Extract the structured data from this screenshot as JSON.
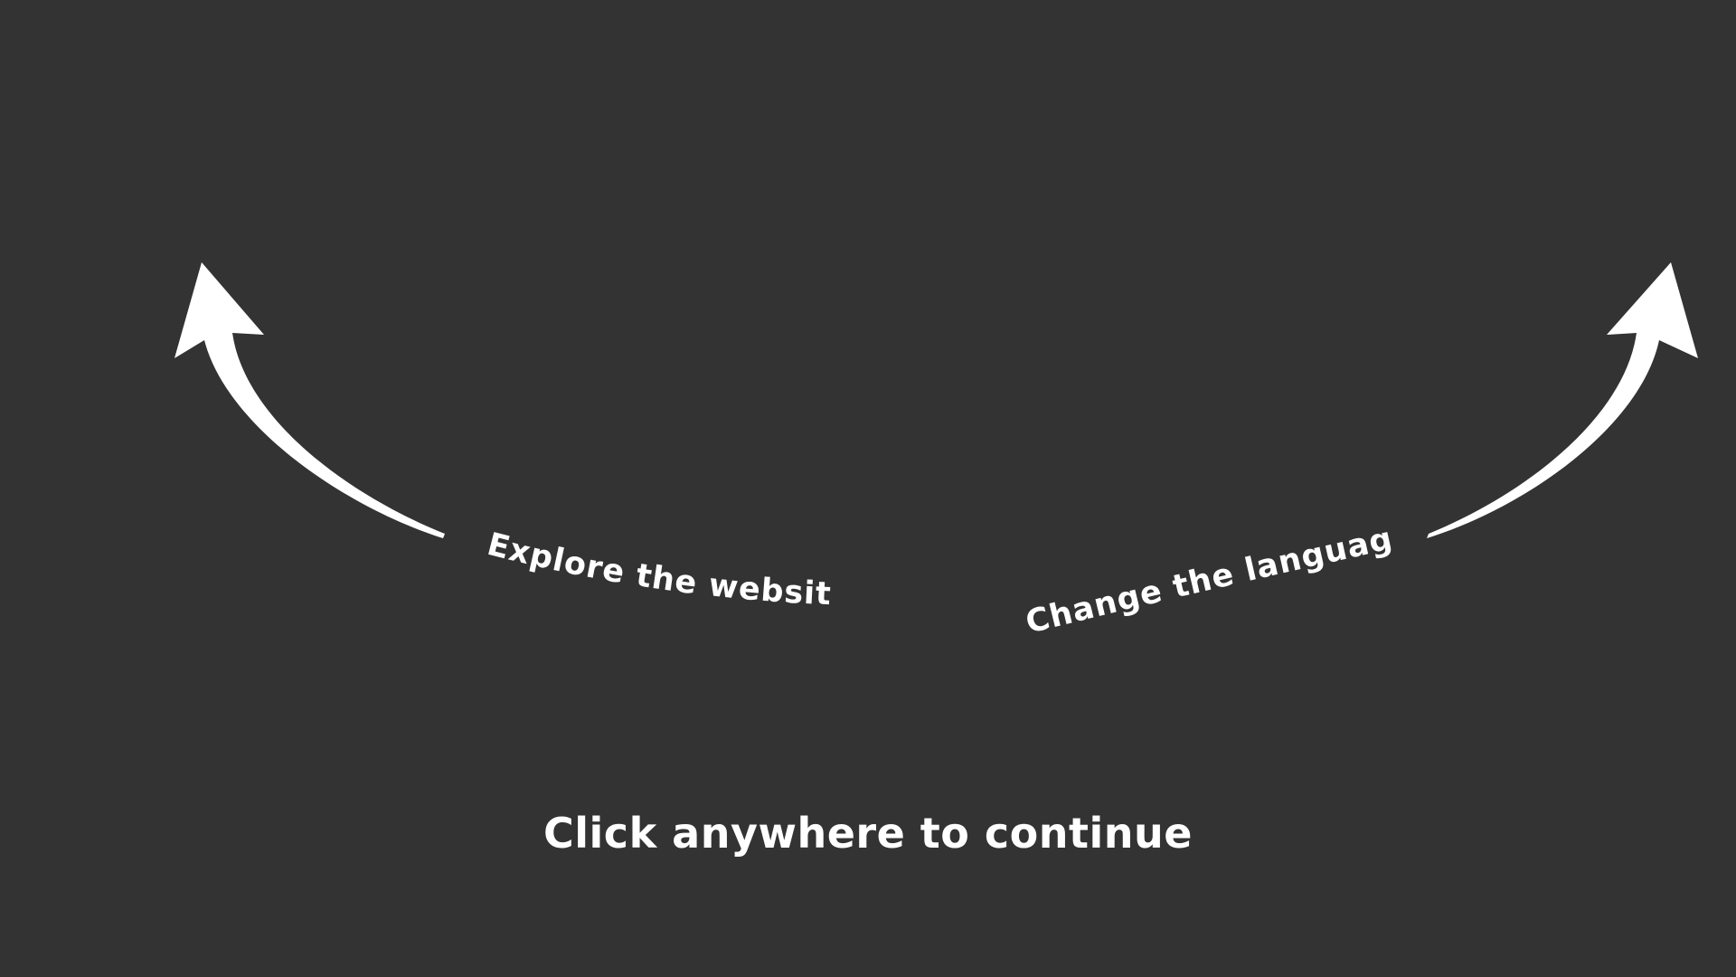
{
  "colors": {
    "background": "#333333",
    "foreground": "#ffffff"
  },
  "hints": {
    "explore": {
      "label": "Explore the website",
      "icon": "curved-arrow-up-left-icon"
    },
    "language": {
      "label": "Change the language",
      "icon": "curved-arrow-up-right-icon"
    }
  },
  "continue_prompt": "Click anywhere to continue"
}
